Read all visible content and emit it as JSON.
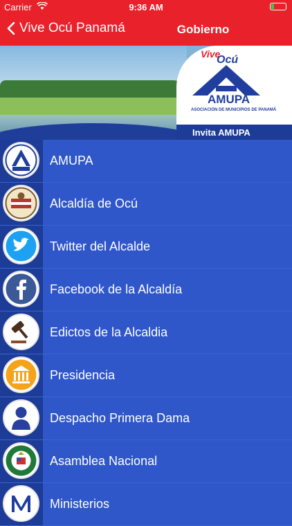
{
  "status": {
    "carrier": "Carrier",
    "time": "9:36 AM"
  },
  "nav": {
    "back_label": "Vive Ocú Panamá",
    "title": "Gobierno"
  },
  "banner": {
    "vive": "Vive",
    "ocu": "Ocú",
    "amupa": "AMUPA",
    "subtitle": "ASOCIACIÓN DE MUNICIPIOS DE PANAMÁ",
    "invita": "Invita AMUPA"
  },
  "items": [
    {
      "label": "AMUPA",
      "icon": "amupa-logo-icon"
    },
    {
      "label": "Alcaldía de Ocú",
      "icon": "ocu-seal-icon"
    },
    {
      "label": "Twitter del Alcalde",
      "icon": "twitter-icon"
    },
    {
      "label": "Facebook de la  Alcaldía",
      "icon": "facebook-icon"
    },
    {
      "label": "Edictos de la Alcaldia",
      "icon": "gavel-icon"
    },
    {
      "label": "Presidencia",
      "icon": "government-building-icon"
    },
    {
      "label": "Despacho Primera Dama",
      "icon": "person-silhouette-icon"
    },
    {
      "label": "Asamblea Nacional",
      "icon": "asamblea-seal-icon"
    },
    {
      "label": "Ministerios",
      "icon": "letter-m-icon"
    }
  ],
  "colors": {
    "navbar": "#e8212b",
    "list_bg": "#2f57c9",
    "icon_column": "#1d3c97",
    "brand_blue": "#1f3e9e"
  }
}
